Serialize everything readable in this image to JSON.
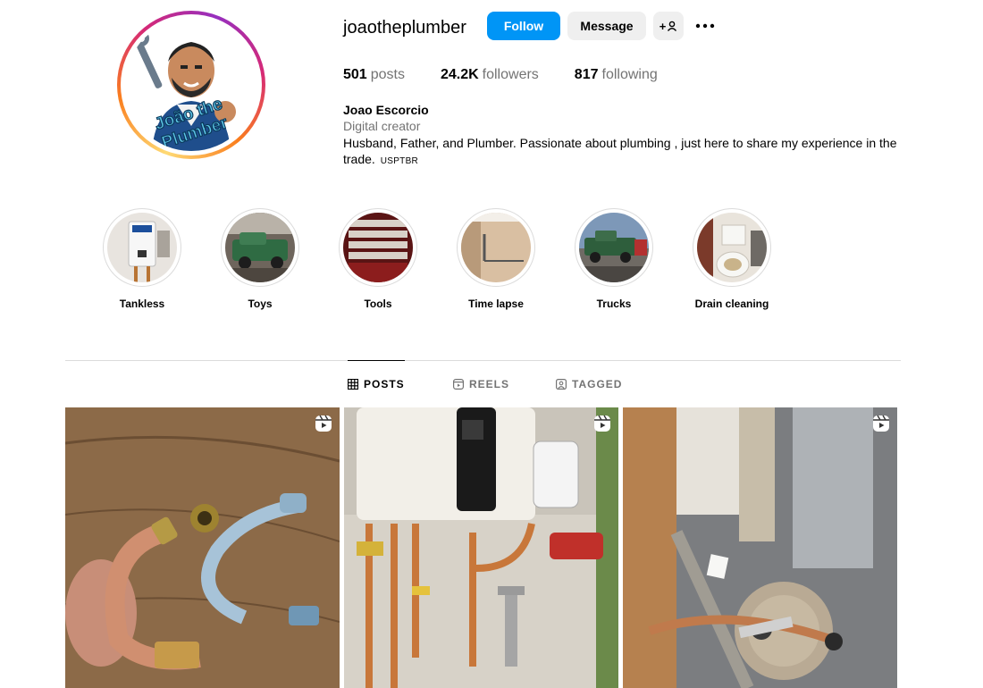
{
  "profile": {
    "username": "joaotheplumber",
    "follow_label": "Follow",
    "message_label": "Message",
    "add_user_label": "+",
    "full_name": "Joao Escorcio",
    "category": "Digital creator",
    "bio": "Husband, Father, and Plumber. Passionate about plumbing , just here to share my experience in the trade.",
    "bio_tag": "USPTBR",
    "avatar_text": [
      "João the",
      "Plumber"
    ]
  },
  "stats": {
    "posts_count": "501",
    "posts_label": "posts",
    "followers_count": "24.2K",
    "followers_label": "followers",
    "following_count": "817",
    "following_label": "following"
  },
  "highlights": [
    {
      "label": "Tankless"
    },
    {
      "label": "Toys"
    },
    {
      "label": "Tools"
    },
    {
      "label": "Time lapse"
    },
    {
      "label": "Trucks"
    },
    {
      "label": "Drain cleaning"
    }
  ],
  "tabs": [
    {
      "label": "POSTS",
      "icon": "grid-icon",
      "active": true
    },
    {
      "label": "REELS",
      "icon": "reels-icon",
      "active": false
    },
    {
      "label": "TAGGED",
      "icon": "tagged-icon",
      "active": false
    }
  ],
  "colors": {
    "accent": "#0095f6",
    "secondary_button": "#efefef",
    "muted_text": "#737373",
    "divider": "#dbdbdb"
  }
}
